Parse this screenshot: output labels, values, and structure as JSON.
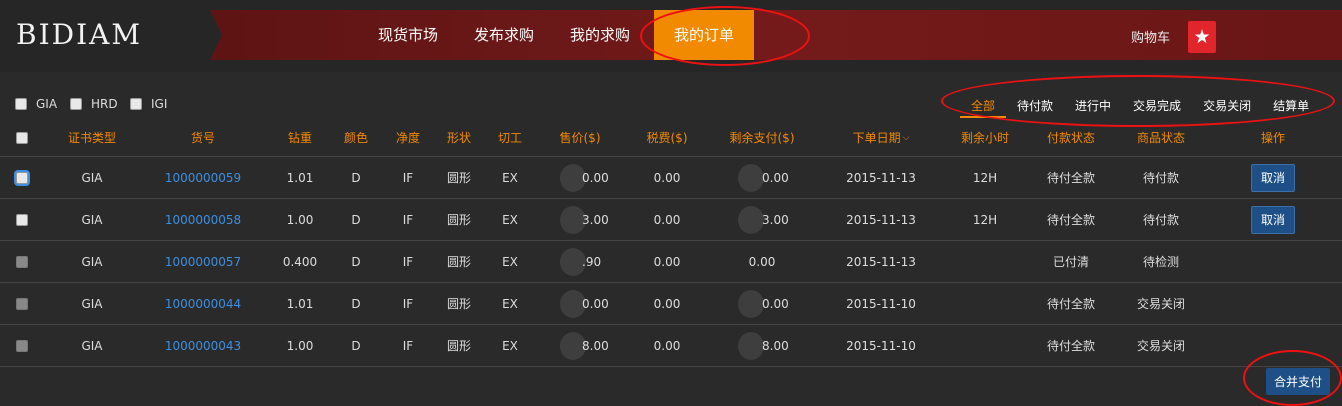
{
  "brand": {
    "logo": "BIDIAM"
  },
  "nav": {
    "items": [
      {
        "label": "现货市场"
      },
      {
        "label": "发布求购"
      },
      {
        "label": "我的求购"
      },
      {
        "label": "我的订单",
        "active": true
      }
    ],
    "cart_label": "购物车",
    "cart_icon": "star-icon"
  },
  "filters": [
    "GIA",
    "HRD",
    "IGI"
  ],
  "status_tabs": [
    "全部",
    "待付款",
    "进行中",
    "交易完成",
    "交易关闭",
    "结算单"
  ],
  "table": {
    "headers": [
      "证书类型",
      "货号",
      "钻重",
      "颜色",
      "净度",
      "形状",
      "切工",
      "售价($)",
      "税费($)",
      "剩余支付($)",
      "下单日期",
      "剩余小时",
      "付款状态",
      "商品状态",
      "操作"
    ],
    "rows": [
      {
        "cert": "GIA",
        "sku": "1000000059",
        "carat": "1.01",
        "color": "D",
        "clarity": "IF",
        "shape": "圆形",
        "cut": "EX",
        "price": "0.00",
        "tax": "0.00",
        "remaining": "0.00",
        "date": "2015-11-13",
        "hours": "12H",
        "pay_status": "待付全款",
        "goods_status": "待付款",
        "action": "取消"
      },
      {
        "cert": "GIA",
        "sku": "1000000058",
        "carat": "1.00",
        "color": "D",
        "clarity": "IF",
        "shape": "圆形",
        "cut": "EX",
        "price": "3.00",
        "tax": "0.00",
        "remaining": "3.00",
        "date": "2015-11-13",
        "hours": "12H",
        "pay_status": "待付全款",
        "goods_status": "待付款",
        "action": "取消"
      },
      {
        "cert": "GIA",
        "sku": "1000000057",
        "carat": "0.400",
        "color": "D",
        "clarity": "IF",
        "shape": "圆形",
        "cut": "EX",
        "price": ".90",
        "tax": "0.00",
        "remaining": "0.00",
        "date": "2015-11-13",
        "hours": "",
        "pay_status": "已付清",
        "goods_status": "待检测",
        "action": ""
      },
      {
        "cert": "GIA",
        "sku": "1000000044",
        "carat": "1.01",
        "color": "D",
        "clarity": "IF",
        "shape": "圆形",
        "cut": "EX",
        "price": "0.00",
        "tax": "0.00",
        "remaining": "0.00",
        "date": "2015-11-10",
        "hours": "",
        "pay_status": "待付全款",
        "goods_status": "交易关闭",
        "action": ""
      },
      {
        "cert": "GIA",
        "sku": "1000000043",
        "carat": "1.00",
        "color": "D",
        "clarity": "IF",
        "shape": "圆形",
        "cut": "EX",
        "price": "8.00",
        "tax": "0.00",
        "remaining": "8.00",
        "date": "2015-11-10",
        "hours": "",
        "pay_status": "待付全款",
        "goods_status": "交易关闭",
        "action": ""
      }
    ]
  },
  "merge_pay_label": "合并支付",
  "colors": {
    "accent": "#f28a00",
    "banner": "#6a1616",
    "button": "#1e4f86",
    "link": "#3d8fe0"
  }
}
